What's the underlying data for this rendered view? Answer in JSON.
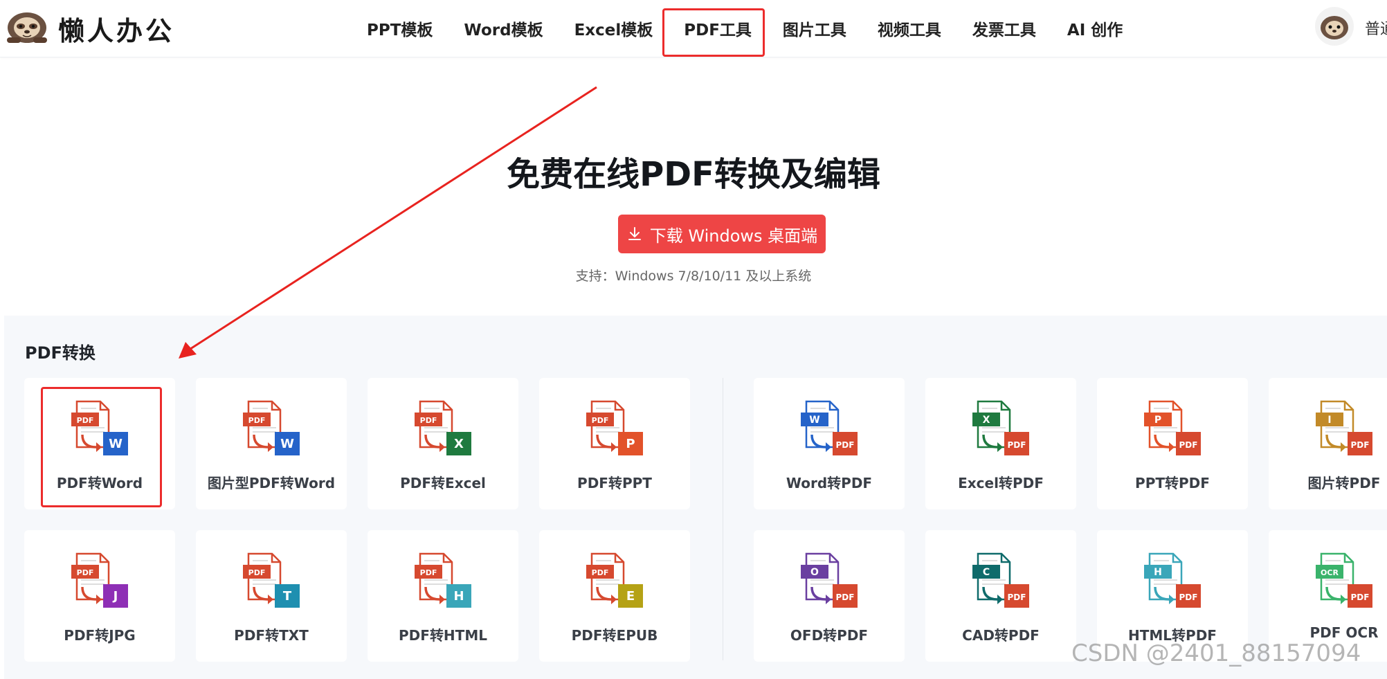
{
  "header": {
    "brand": "懒人办公",
    "nav": [
      "PPT模板",
      "Word模板",
      "Excel模板",
      "PDF工具",
      "图片工具",
      "视频工具",
      "发票工具",
      "AI 创作"
    ],
    "active_nav": "PDF工具",
    "user_text": "普通"
  },
  "hero": {
    "title": "免费在线PDF转换及编辑",
    "download_label": "下载 Windows 桌面端",
    "support_text": "支持：Windows 7/8/10/11 及以上系统"
  },
  "section": {
    "title": "PDF转换",
    "cards": [
      {
        "label": "PDF转Word",
        "badge": "W",
        "top": "PDF",
        "doc_color": "#d6492f",
        "badge_color": "#2563c9",
        "dir": "from"
      },
      {
        "label": "图片型PDF转Word",
        "badge": "W",
        "top": "PDF",
        "doc_color": "#d6492f",
        "badge_color": "#2563c9",
        "dir": "from"
      },
      {
        "label": "PDF转Excel",
        "badge": "X",
        "top": "PDF",
        "doc_color": "#d6492f",
        "badge_color": "#1f7a3f",
        "dir": "from"
      },
      {
        "label": "PDF转PPT",
        "badge": "P",
        "top": "PDF",
        "doc_color": "#d6492f",
        "badge_color": "#e2522a",
        "dir": "from"
      },
      {
        "label": "Word转PDF",
        "badge": "PDF",
        "top": "W",
        "doc_color": "#2563c9",
        "badge_color": "#d6492f",
        "dir": "to"
      },
      {
        "label": "Excel转PDF",
        "badge": "PDF",
        "top": "X",
        "doc_color": "#1f7a3f",
        "badge_color": "#d6492f",
        "dir": "to"
      },
      {
        "label": "PPT转PDF",
        "badge": "PDF",
        "top": "P",
        "doc_color": "#e2522a",
        "badge_color": "#d6492f",
        "dir": "to"
      },
      {
        "label": "图片转PDF",
        "badge": "PDF",
        "top": "I",
        "doc_color": "#c28a28",
        "badge_color": "#d6492f",
        "dir": "to"
      },
      {
        "label": "PDF转JPG",
        "badge": "J",
        "top": "PDF",
        "doc_color": "#d6492f",
        "badge_color": "#8e2fb5",
        "dir": "from"
      },
      {
        "label": "PDF转TXT",
        "badge": "T",
        "top": "PDF",
        "doc_color": "#d6492f",
        "badge_color": "#1f8fb0",
        "dir": "from"
      },
      {
        "label": "PDF转HTML",
        "badge": "H",
        "top": "PDF",
        "doc_color": "#d6492f",
        "badge_color": "#3aa6b9",
        "dir": "from"
      },
      {
        "label": "PDF转EPUB",
        "badge": "E",
        "top": "PDF",
        "doc_color": "#d6492f",
        "badge_color": "#b5a215",
        "dir": "from"
      },
      {
        "label": "OFD转PDF",
        "badge": "PDF",
        "top": "O",
        "doc_color": "#6a3fa0",
        "badge_color": "#d6492f",
        "dir": "to"
      },
      {
        "label": "CAD转PDF",
        "badge": "PDF",
        "top": "C",
        "doc_color": "#0f6b6b",
        "badge_color": "#d6492f",
        "dir": "to"
      },
      {
        "label": "HTML转PDF",
        "badge": "PDF",
        "top": "H",
        "doc_color": "#3aa6b9",
        "badge_color": "#d6492f",
        "dir": "to"
      },
      {
        "label": "PDF OCR",
        "badge": "PDF",
        "top": "OCR",
        "doc_color": "#3ab36b",
        "badge_color": "#d6492f",
        "dir": "to"
      }
    ]
  },
  "watermark": "CSDN @2401_88157094"
}
